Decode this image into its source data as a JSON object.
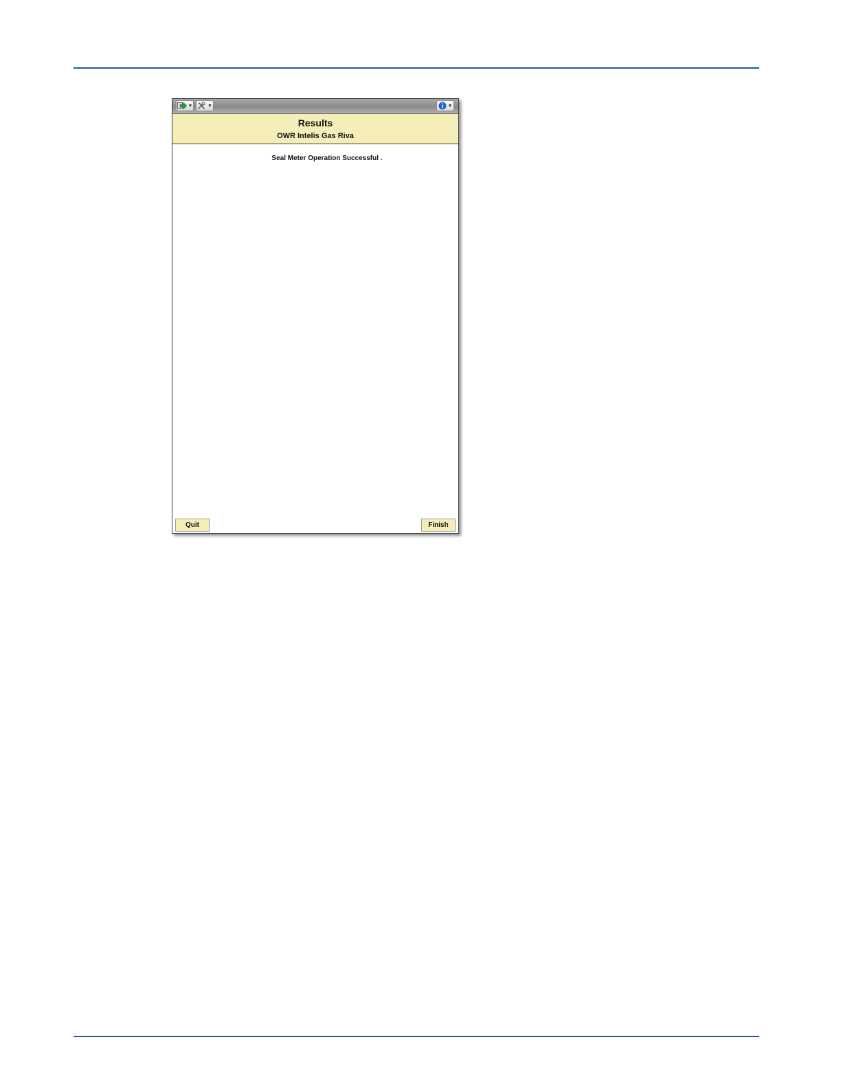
{
  "toolbar": {
    "nav_icon": "nav-arrow-icon",
    "tools_icon": "tools-icon",
    "info_icon": "info-icon"
  },
  "header": {
    "title": "Results",
    "subtitle": "OWR Intelis Gas Riva"
  },
  "main": {
    "message": "Seal Meter Operation Successful ."
  },
  "buttons": {
    "quit_label": "Quit",
    "finish_label": "Finish"
  },
  "colors": {
    "header_bg": "#f6eeb8",
    "rule": "#1f5a96",
    "info_blue": "#1e64c8",
    "nav_green": "#2e9e3e"
  }
}
